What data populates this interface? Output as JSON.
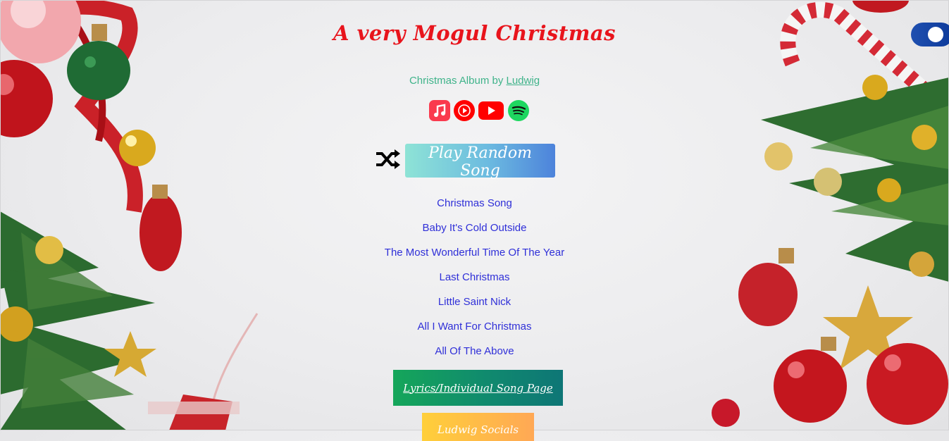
{
  "header": {
    "title": "A very Mogul Christmas"
  },
  "byline": {
    "prefix": "Christmas Album by",
    "artist": "Ludwig"
  },
  "platforms": [
    {
      "name": "Apple Music",
      "icon": "apple-music-icon"
    },
    {
      "name": "YouTube Music",
      "icon": "youtube-music-icon"
    },
    {
      "name": "YouTube",
      "icon": "youtube-icon"
    },
    {
      "name": "Spotify",
      "icon": "spotify-icon"
    }
  ],
  "actions": {
    "shuffle_icon": "shuffle-icon",
    "play_random_label": "Play Random Song",
    "lyrics_label": "Lyrics/Individual Song Page",
    "socials_label": "Ludwig Socials"
  },
  "songs": [
    "Christmas Song",
    "Baby It's Cold Outside",
    "The Most Wonderful Time Of The Year",
    "Last Christmas",
    "Little Saint Nick",
    "All I Want For Christmas",
    "All Of The Above"
  ],
  "theme": {
    "title_color": "#e8141c",
    "byline_color": "#3fb38a",
    "link_color": "#2f2fd8",
    "toggle_color": "#1e4fb0"
  },
  "toggle": {
    "state": "on"
  }
}
